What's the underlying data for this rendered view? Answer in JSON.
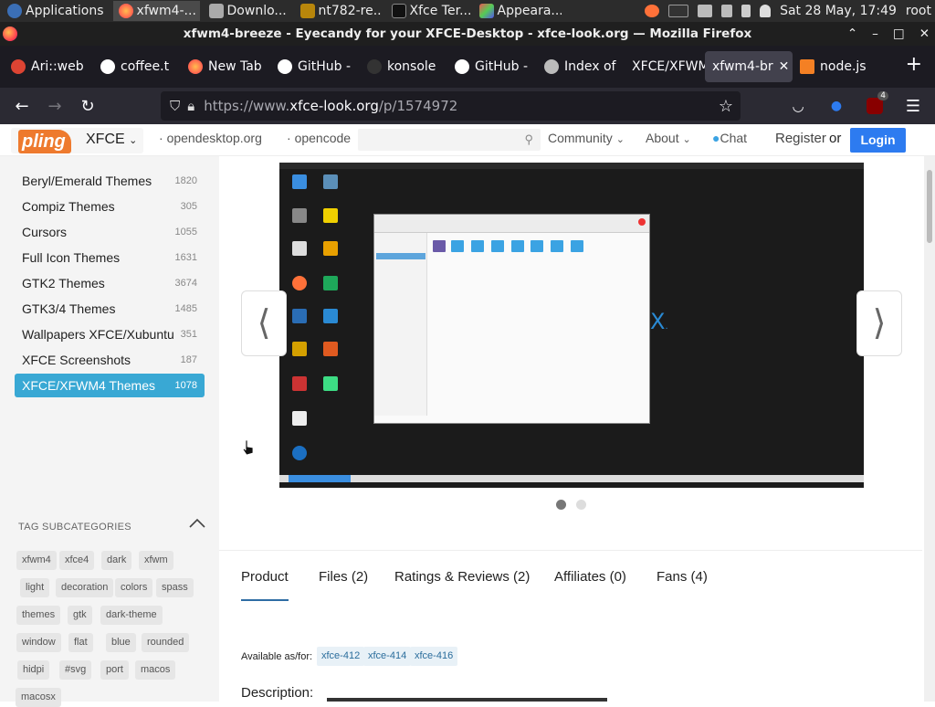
{
  "panel": {
    "applications_label": "Applications",
    "tasks": [
      {
        "label": "xfwm4-...",
        "icon": "firefox-icon",
        "active": true
      },
      {
        "label": "Downlo...",
        "icon": "folder-icon"
      },
      {
        "label": "nt782-re...",
        "icon": "editor-icon"
      },
      {
        "label": "Xfce Ter...",
        "icon": "terminal-icon"
      },
      {
        "label": "Appeara...",
        "icon": "appearance-icon"
      }
    ],
    "datetime": "Sat 28 May, 17:49",
    "user": "root"
  },
  "window": {
    "title": "xfwm4-breeze - Eyecandy for your XFCE-Desktop - xfce-look.org — Mozilla Firefox"
  },
  "tabs": [
    {
      "label": "Ari::web",
      "icon": "globe-icon"
    },
    {
      "label": "coffee.t",
      "icon": "github-icon"
    },
    {
      "label": "New Tab",
      "icon": "firefox-icon"
    },
    {
      "label": "GitHub -",
      "icon": "github-icon"
    },
    {
      "label": "konsole",
      "icon": "github-icon"
    },
    {
      "label": "GitHub -",
      "icon": "github-icon"
    },
    {
      "label": "Index of",
      "icon": "gear-icon"
    },
    {
      "label": "XFCE/XFWM",
      "icon": "none"
    },
    {
      "label": "xfwm4-br",
      "icon": "none",
      "selected": true
    },
    {
      "label": "node.js",
      "icon": "stackoverflow-icon"
    }
  ],
  "nav": {
    "url_prefix": "https://www.",
    "url_host": "xfce-look.org",
    "url_path": "/p/1574972",
    "ublock_count": "4"
  },
  "site": {
    "logo": "pling",
    "section": "XFCE",
    "links": [
      "opendesktop.org",
      "opencode"
    ],
    "community": "Community",
    "about": "About",
    "chat": "Chat",
    "register": "Register",
    "or": "or",
    "login": "Login"
  },
  "sidebar": {
    "categories": [
      {
        "label": "Beryl/Emerald Themes",
        "count": "1820"
      },
      {
        "label": "Compiz Themes",
        "count": "305"
      },
      {
        "label": "Cursors",
        "count": "1055"
      },
      {
        "label": "Full Icon Themes",
        "count": "1631"
      },
      {
        "label": "GTK2 Themes",
        "count": "3674"
      },
      {
        "label": "GTK3/4 Themes",
        "count": "1485"
      },
      {
        "label": "Wallpapers XFCE/Xubuntu",
        "count": "351"
      },
      {
        "label": "XFCE Screenshots",
        "count": "187"
      },
      {
        "label": "XFCE/XFWM4 Themes",
        "count": "1078",
        "selected": true
      }
    ],
    "tag_title": "TAG SUBCATEGORIES",
    "tags": [
      "xfwm4",
      "xfce4",
      "dark",
      "xfwm",
      "light",
      "decoration",
      "colors",
      "spass",
      "themes",
      "gtk",
      "dark-theme",
      "window",
      "flat",
      "blue",
      "rounded",
      "hidpi",
      "#svg",
      "port",
      "macos",
      "macosx"
    ]
  },
  "product": {
    "tabs": [
      "Product",
      "Files (2)",
      "Ratings & Reviews (2)",
      "Affiliates (0)",
      "Fans (4)"
    ],
    "available_label": "Available as/for:",
    "versions": [
      "xfce-412",
      "xfce-414",
      "xfce-416"
    ],
    "description_label": "Description:",
    "slide_index": 1,
    "slide_count": 2
  },
  "colors": {
    "accent": "#39a8d4",
    "login": "#2d7bf0",
    "pling": "#ee7a2e"
  }
}
